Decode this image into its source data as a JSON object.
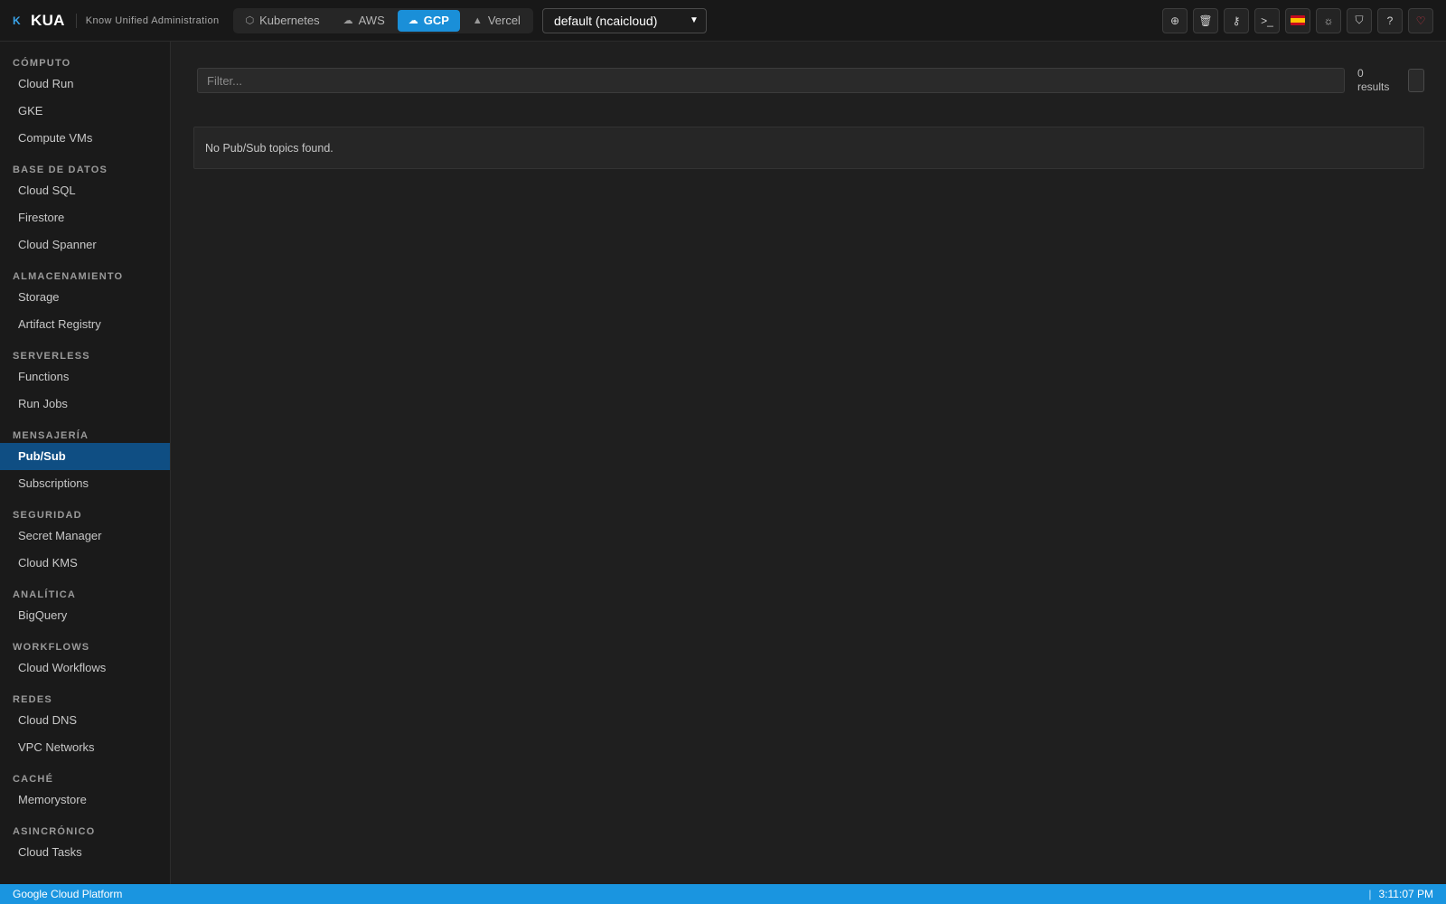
{
  "brand": {
    "logo": "K",
    "name": "KUA",
    "subtitle": "Know Unified Administration"
  },
  "providers": [
    {
      "label": "Kubernetes",
      "icon": "cube-icon",
      "glyph": "⬡",
      "active": false
    },
    {
      "label": "AWS",
      "icon": "cloud-icon",
      "glyph": "☁",
      "active": false
    },
    {
      "label": "GCP",
      "icon": "cloud-upload-icon",
      "glyph": "☁",
      "active": true
    },
    {
      "label": "Vercel",
      "icon": "triangle-icon",
      "glyph": "▲",
      "active": false
    }
  ],
  "project_select": {
    "value": "default (ncaicloud)"
  },
  "toolbar": [
    {
      "name": "add-icon",
      "glyph": "⊕"
    },
    {
      "name": "trash-icon",
      "glyph": "🗑"
    },
    {
      "name": "key-icon",
      "glyph": "⚷"
    },
    {
      "name": "terminal-icon",
      "glyph": ">_"
    },
    {
      "name": "spain-flag-icon",
      "glyph": ""
    },
    {
      "name": "sun-icon",
      "glyph": "☼"
    },
    {
      "name": "shield-icon",
      "glyph": "⛉"
    },
    {
      "name": "help-icon",
      "glyph": "?"
    },
    {
      "name": "heart-icon",
      "glyph": "♡"
    }
  ],
  "sidebar": {
    "sections": [
      {
        "title": "CÓMPUTO",
        "items": [
          "Cloud Run",
          "GKE",
          "Compute VMs"
        ]
      },
      {
        "title": "BASE DE DATOS",
        "items": [
          "Cloud SQL",
          "Firestore",
          "Cloud Spanner"
        ]
      },
      {
        "title": "ALMACENAMIENTO",
        "items": [
          "Storage",
          "Artifact Registry"
        ]
      },
      {
        "title": "SERVERLESS",
        "items": [
          "Functions",
          "Run Jobs"
        ]
      },
      {
        "title": "MENSAJERÍA",
        "items": [
          "Pub/Sub",
          "Subscriptions"
        ]
      },
      {
        "title": "SEGURIDAD",
        "items": [
          "Secret Manager",
          "Cloud KMS"
        ]
      },
      {
        "title": "ANALÍTICA",
        "items": [
          "BigQuery"
        ]
      },
      {
        "title": "WORKFLOWS",
        "items": [
          "Cloud Workflows"
        ]
      },
      {
        "title": "REDES",
        "items": [
          "Cloud DNS",
          "VPC Networks"
        ]
      },
      {
        "title": "CACHÉ",
        "items": [
          "Memorystore"
        ]
      },
      {
        "title": "ASINCRÓNICO",
        "items": [
          "Cloud Tasks"
        ]
      }
    ],
    "active_item": "Pub/Sub"
  },
  "main": {
    "filter_placeholder": "Filter...",
    "results_count": "0",
    "results_label": "results",
    "empty_message": "No Pub/Sub topics found."
  },
  "statusbar": {
    "left": "Google Cloud Platform",
    "separator": "|",
    "time": "3:11:07 PM"
  },
  "colors": {
    "accent": "#1a8fd8",
    "active_nav": "#0f4e83",
    "statusbar": "#1a95e0",
    "heart": "#e0394a"
  }
}
